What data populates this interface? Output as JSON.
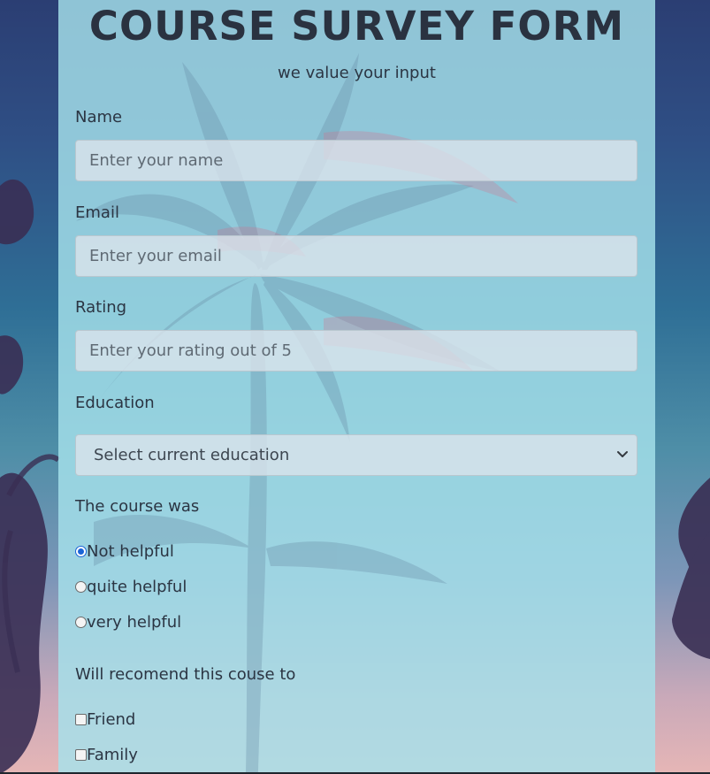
{
  "header": {
    "title": "COURSE SURVEY FORM",
    "subtitle": "we value your input"
  },
  "form": {
    "name": {
      "label": "Name",
      "placeholder": "Enter your name",
      "value": ""
    },
    "email": {
      "label": "Email",
      "placeholder": "Enter your email",
      "value": ""
    },
    "rating": {
      "label": "Rating",
      "placeholder": "Enter your rating out of 5",
      "value": ""
    },
    "education": {
      "label": "Education",
      "selected": "Select current education"
    },
    "course_was": {
      "label": "The course was",
      "options": [
        {
          "label": "Not helpful",
          "checked": true
        },
        {
          "label": "quite helpful",
          "checked": false
        },
        {
          "label": "very helpful",
          "checked": false
        }
      ]
    },
    "recommend": {
      "label": "Will recomend this couse to",
      "options": [
        {
          "label": "Friend",
          "checked": false
        },
        {
          "label": "Family",
          "checked": false
        }
      ]
    }
  },
  "colors": {
    "panel_bg": "#a6e2ec",
    "text": "#2b3543",
    "radio_selected": "#1a64d6"
  },
  "icons": {
    "select_arrow": "chevron-down-icon"
  }
}
